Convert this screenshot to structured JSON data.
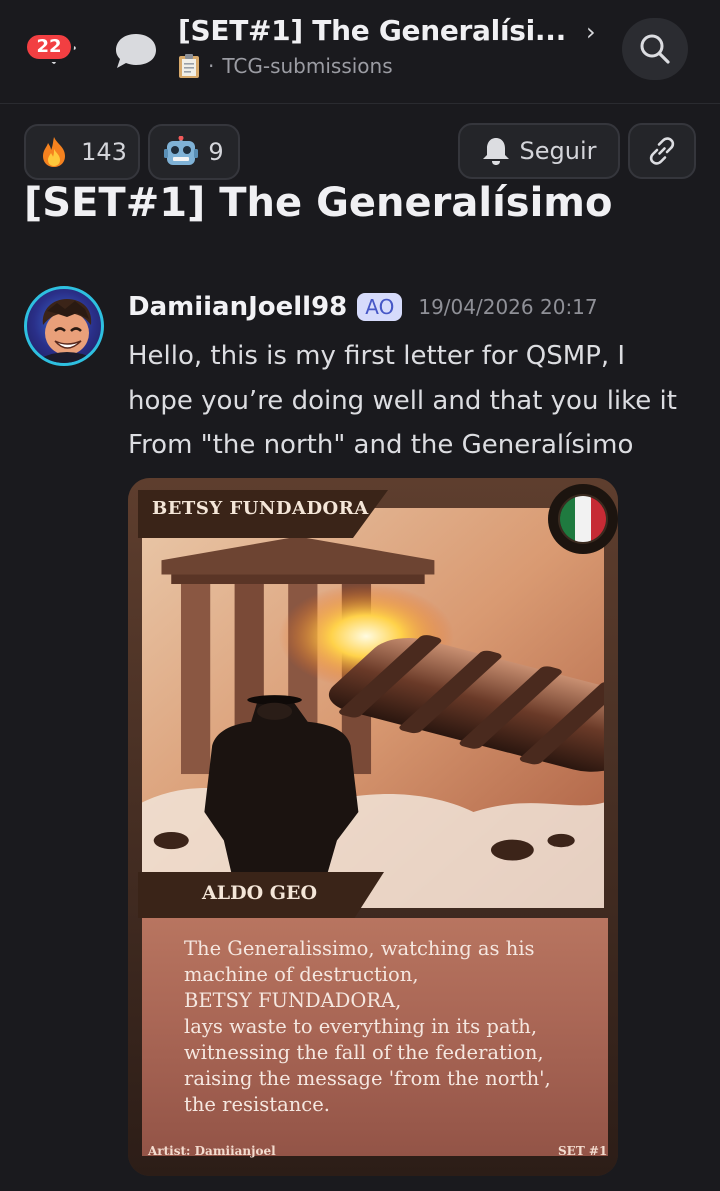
{
  "header": {
    "back_badge_count": "22",
    "thread_title": "[SET#1] The Generalísi...",
    "channel": "TCG-submissions",
    "channel_prefix": "·"
  },
  "actions": {
    "reaction_fire_count": "143",
    "reaction_robot_count": "9",
    "follow_label": "Seguir"
  },
  "post": {
    "title": "[SET#1] The Generalísimo",
    "author": "DamiianJoell98",
    "role_tag": "AO",
    "timestamp": "19/04/2026 20:17",
    "lines": [
      "Hello, this is my first letter for QSMP, I",
      "hope you’re doing well and that you like it",
      "From \"the north\" and the Generalísimo"
    ]
  },
  "card": {
    "title": "BETSY FUNDADORA",
    "name": "ALDO GEO",
    "flavor_lines": [
      "The Generalissimo, watching as his",
      "machine of destruction,",
      "BETSY FUNDADORA,",
      "lays waste to everything in its path,",
      "witnessing the fall of the federation,",
      "raising the message 'from the north',",
      "the resistance."
    ],
    "artist": "Artist: Damiianjoel",
    "set": "SET #1",
    "flag_colors": [
      "#1f7a3f",
      "#f2f2f2",
      "#c62b35"
    ]
  },
  "icons": [
    "arrow-left-icon",
    "chat-bubble-icon",
    "clipboard-icon",
    "search-icon",
    "fire-emoji-icon",
    "robot-emoji-icon",
    "bell-icon",
    "link-icon"
  ],
  "colors": {
    "badge": "#f23f42",
    "background": "#1a1a1e",
    "tag_bg": "#d6dbfb",
    "tag_fg": "#4657c6"
  }
}
